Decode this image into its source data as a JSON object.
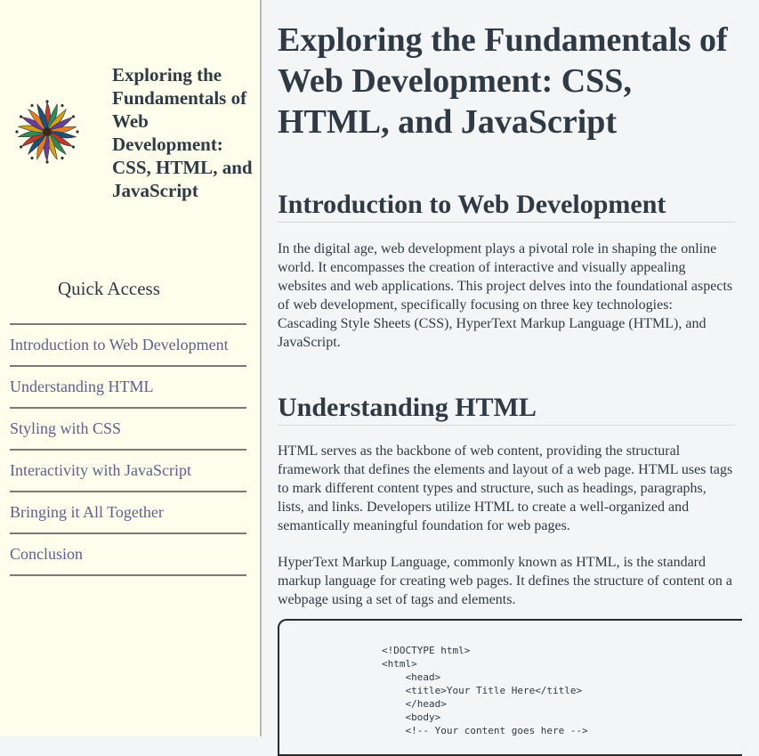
{
  "sidebar": {
    "title": "Exploring the Fundamentals of Web Development: CSS, HTML, and JavaScript",
    "quick_access": "Quick Access",
    "nav": [
      "Introduction to Web Development",
      "Understanding HTML",
      "Styling with CSS",
      "Interactivity with JavaScript",
      "Bringing it All Together",
      "Conclusion"
    ]
  },
  "main": {
    "title": "Exploring the Fundamentals of Web Development: CSS, HTML, and JavaScript",
    "sections": [
      {
        "heading": "Introduction to Web Development",
        "paragraphs": [
          "In the digital age, web development plays a pivotal role in shaping the online world. It encompasses the creation of interactive and visually appealing websites and web applications. This project delves into the foundational aspects of web development, specifically focusing on three key technologies: Cascading Style Sheets (CSS), HyperText Markup Language (HTML), and JavaScript."
        ]
      },
      {
        "heading": "Understanding HTML",
        "paragraphs": [
          "HTML serves as the backbone of web content, providing the structural framework that defines the elements and layout of a web page. HTML uses tags to mark different content types and structure, such as headings, paragraphs, lists, and links. Developers utilize HTML to create a well-organized and semantically meaningful foundation for web pages.",
          "HyperText Markup Language, commonly known as HTML, is the standard markup language for creating web pages. It defines the structure of content on a webpage using a set of tags and elements."
        ]
      }
    ],
    "code": "<!DOCTYPE html>\n<html>\n    <head>\n    <title>Your Title Here</title>\n    </head>\n    <body>\n    <!-- Your content goes here -->"
  },
  "colors": {
    "sidebar_bg": "#fefeec",
    "main_bg": "#f4f5f7",
    "text": "#2f3a45",
    "link": "#5f5f90"
  },
  "icons": {
    "logo": "mandala-logo-icon"
  }
}
